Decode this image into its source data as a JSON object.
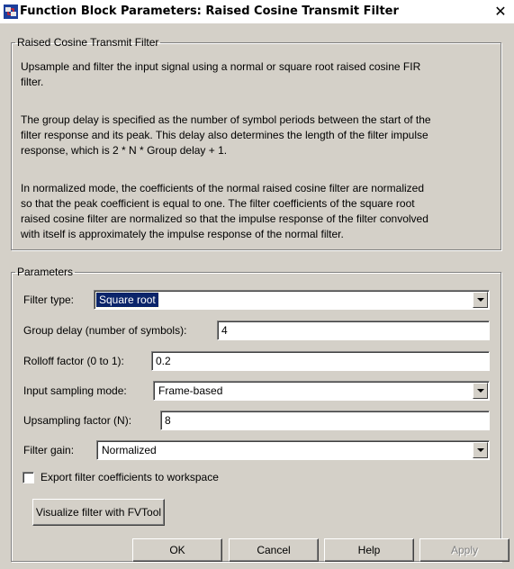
{
  "window": {
    "title": "Function Block Parameters: Raised Cosine Transmit Filter",
    "close_glyph": "✕"
  },
  "description_group": {
    "legend": "Raised Cosine Transmit Filter",
    "para1_line1": "Upsample and filter the input signal using a normal or square root raised cosine FIR",
    "para1_line2": "filter.",
    "para2_line1": "The group delay is specified as the number of symbol periods between the start of the",
    "para2_line2": "filter response and its peak. This delay also determines the length of the filter impulse",
    "para2_line3": "response, which is 2 * N * Group delay + 1.",
    "para3_line1": "In normalized mode, the coefficients of the normal raised cosine filter are normalized",
    "para3_line2": "so that the peak coefficient is equal to one. The filter coefficients of the square root",
    "para3_line3": "raised cosine filter are normalized so that the impulse response of the filter convolved",
    "para3_line4": "with itself is approximately the impulse response of the normal filter."
  },
  "parameters_group": {
    "legend": "Parameters",
    "filter_type": {
      "label": "Filter type:",
      "value": "Square root"
    },
    "group_delay": {
      "label": "Group delay (number of symbols):",
      "value": "4"
    },
    "rolloff": {
      "label": "Rolloff factor (0 to 1):",
      "value": "0.2"
    },
    "input_sampling_mode": {
      "label": "Input sampling mode:",
      "value": "Frame-based"
    },
    "upsampling_factor": {
      "label": "Upsampling factor (N):",
      "value": "8"
    },
    "filter_gain": {
      "label": "Filter gain:",
      "value": "Normalized"
    },
    "export_checkbox": {
      "label": "Export filter coefficients to workspace",
      "checked": false
    },
    "visualize_button": "Visualize filter with FVTool"
  },
  "buttons": {
    "ok": "OK",
    "cancel": "Cancel",
    "help": "Help",
    "apply": "Apply"
  },
  "icons": {
    "app": "simulink-block-icon",
    "dropdown": "chevron-down-icon",
    "close": "close-icon"
  },
  "colors": {
    "dialog_bg": "#d4d0c8",
    "selection": "#0a246a"
  }
}
